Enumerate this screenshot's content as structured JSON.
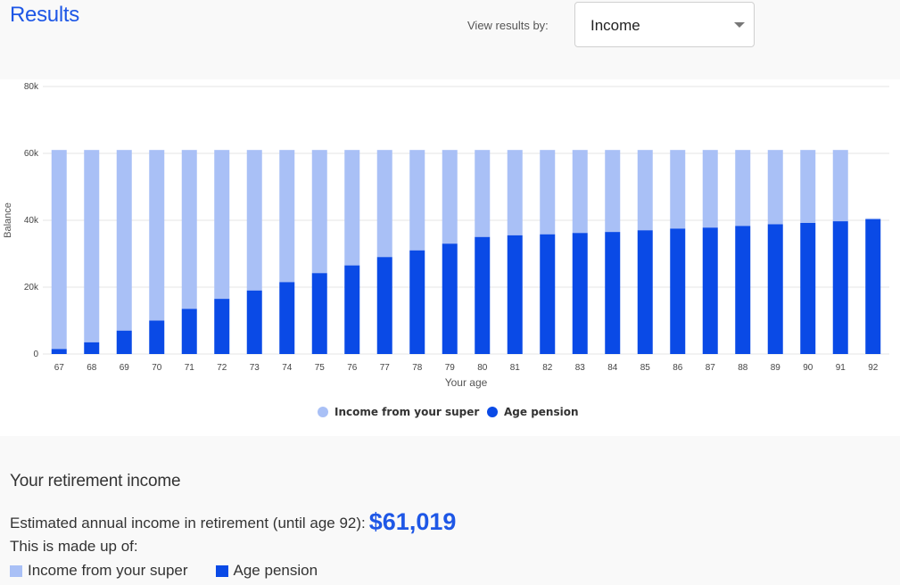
{
  "header": {
    "title": "Results",
    "view_label": "View results by:",
    "view_select": {
      "value": "Income"
    }
  },
  "colors": {
    "super": "#a9c0f6",
    "pension": "#0a4ae6",
    "accent": "#1e57e6"
  },
  "chart_data": {
    "type": "bar",
    "stacked": true,
    "title": "",
    "xlabel": "Your age",
    "ylabel": "Balance",
    "ylim": [
      0,
      80000
    ],
    "yticks": [
      0,
      20000,
      40000,
      60000,
      80000
    ],
    "ytick_labels": [
      "0",
      "20k",
      "40k",
      "60k",
      "80k"
    ],
    "grid": true,
    "legend": "bottom-center",
    "categories": [
      "67",
      "68",
      "69",
      "70",
      "71",
      "72",
      "73",
      "74",
      "75",
      "76",
      "77",
      "78",
      "79",
      "80",
      "81",
      "82",
      "83",
      "84",
      "85",
      "86",
      "87",
      "88",
      "89",
      "90",
      "91",
      "92"
    ],
    "series": [
      {
        "name": "Age pension",
        "color": "#0a4ae6",
        "values": [
          1500,
          3500,
          7000,
          10000,
          13500,
          16500,
          19000,
          21500,
          24200,
          26500,
          29000,
          31000,
          33000,
          35000,
          35500,
          35800,
          36200,
          36500,
          37000,
          37500,
          37800,
          38300,
          38800,
          39200,
          39700,
          40300
        ]
      },
      {
        "name": "Income from your super",
        "color": "#a9c0f6",
        "values": [
          59519,
          57519,
          54019,
          51019,
          47519,
          44519,
          42019,
          39519,
          36819,
          34519,
          32019,
          30019,
          28019,
          26019,
          25519,
          25219,
          24819,
          24519,
          24019,
          23519,
          23219,
          22719,
          22219,
          21819,
          21319,
          300
        ]
      }
    ]
  },
  "summary": {
    "heading": "Your retirement income",
    "estimated_label": "Estimated annual income in retirement (until age 92):",
    "amount": "$61,019",
    "made_up_label": "This is made up of:",
    "key_super": "Income from your super",
    "key_pension": "Age pension"
  }
}
